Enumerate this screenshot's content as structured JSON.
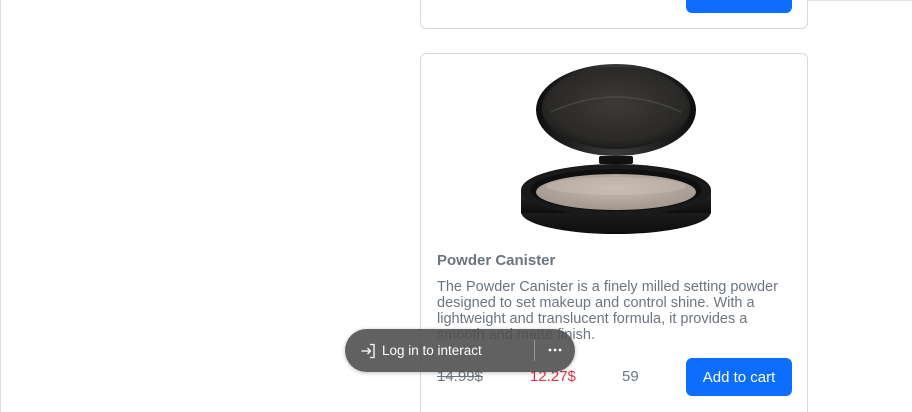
{
  "product": {
    "title": "Powder Canister",
    "description": "The Powder Canister is a finely milled setting powder designed to set makeup and control shine. With a lightweight and translucent formula, it provides a smooth and matte finish.",
    "original_price": "14.99$",
    "sale_price": "12.27$",
    "stock": "59",
    "add_to_cart_label": "Add to cart",
    "image_icon": "powder-compact"
  },
  "login_overlay": {
    "label": "Log in to interact",
    "login_icon": "sign-in-arrow",
    "more_icon": "ellipsis"
  },
  "colors": {
    "primary_button": "#0d6efd",
    "sale_price": "#dc3545",
    "muted_text": "#6c757d",
    "overlay_bg": "#505050"
  }
}
